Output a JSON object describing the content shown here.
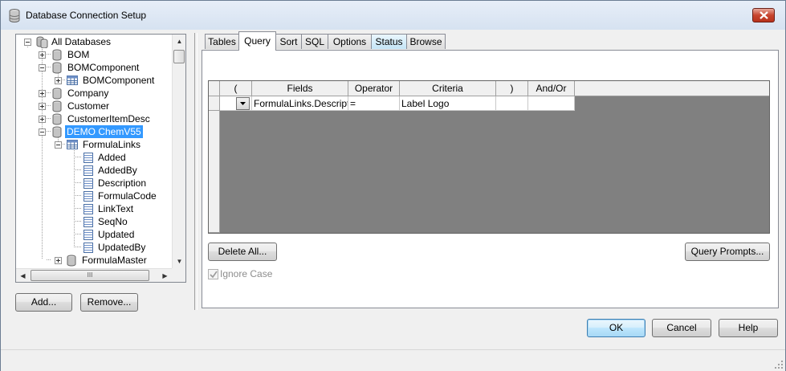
{
  "window": {
    "title": "Database Connection Setup"
  },
  "tree": {
    "items": [
      {
        "label": "All Databases"
      },
      {
        "label": "BOM"
      },
      {
        "label": "BOMComponent"
      },
      {
        "label": "BOMComponent"
      },
      {
        "label": "Company"
      },
      {
        "label": "Customer"
      },
      {
        "label": "CustomerItemDesc"
      },
      {
        "label": "DEMO ChemV55"
      },
      {
        "label": "FormulaLinks"
      },
      {
        "label": "Added"
      },
      {
        "label": "AddedBy"
      },
      {
        "label": "Description"
      },
      {
        "label": "FormulaCode"
      },
      {
        "label": "LinkText"
      },
      {
        "label": "SeqNo"
      },
      {
        "label": "Updated"
      },
      {
        "label": "UpdatedBy"
      },
      {
        "label": "FormulaMaster"
      }
    ],
    "hscroll_grip": "III"
  },
  "left_buttons": {
    "add": "Add...",
    "remove": "Remove..."
  },
  "tabs": [
    {
      "label": "Tables"
    },
    {
      "label": "Query"
    },
    {
      "label": "Sort"
    },
    {
      "label": "SQL"
    },
    {
      "label": "Options"
    },
    {
      "label": "Status"
    },
    {
      "label": "Browse"
    }
  ],
  "grid": {
    "columns": [
      "(",
      "Fields",
      "Operator",
      "Criteria",
      ")",
      "And/Or"
    ],
    "rows": [
      {
        "open_paren": "",
        "field": "FormulaLinks.Description",
        "operator": "=",
        "criteria": "Label Logo",
        "close_paren": "",
        "and_or": ""
      }
    ]
  },
  "query_buttons": {
    "delete_all": "Delete All...",
    "query_prompts": "Query Prompts..."
  },
  "ignore_case": {
    "label": "Ignore Case",
    "checked": true
  },
  "footer_buttons": {
    "ok": "OK",
    "cancel": "Cancel",
    "help": "Help"
  },
  "colors": {
    "selection": "#3399ff",
    "grid_background": "#808080",
    "close_button": "#c7442e"
  }
}
